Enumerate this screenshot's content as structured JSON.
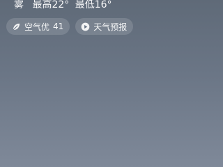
{
  "weather": {
    "condition": "雾",
    "high": "最高22°",
    "low": "最低16°"
  },
  "chips": {
    "air_quality": {
      "label": "空气优",
      "value": "41",
      "icon": "leaf-icon"
    },
    "forecast": {
      "label": "天气预报",
      "icon": "play-icon"
    }
  },
  "colors": {
    "background_top": "#5f6a78",
    "background_bottom": "#7f8999"
  }
}
